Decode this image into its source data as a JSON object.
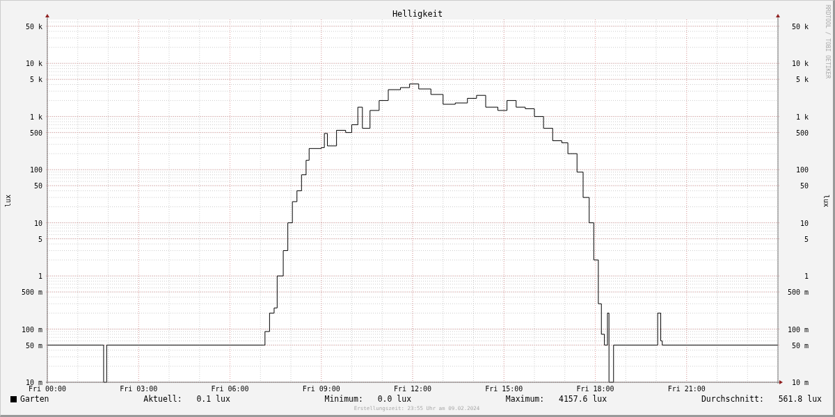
{
  "credit": "RRDTOOL / TOBI OETIKER",
  "graph": {
    "title": "Helligkeit",
    "ylabel": "lux",
    "right_axis_label": "lux",
    "x_tick_labels": [
      "Fri 00:00",
      "Fri 03:00",
      "Fri 06:00",
      "Fri 09:00",
      "Fri 12:00",
      "Fri 15:00",
      "Fri 18:00",
      "Fri 21:00"
    ],
    "y_tick_labels": [
      "50 k",
      "10 k",
      "5 k",
      "1 k",
      "500",
      "100",
      "50",
      "10",
      "5",
      "1",
      "500 m",
      "100 m",
      "50 m",
      "10 m"
    ],
    "right_y_tick_labels": [
      "50 k",
      "10 k",
      "5 k",
      "1 k",
      "500",
      "100",
      "50",
      "10",
      "5",
      "1",
      "500 m",
      "100 m",
      "50 m",
      "10 m"
    ]
  },
  "legend": {
    "series_label": "Garten",
    "color": "#000000",
    "stats": [
      {
        "label": "Aktuell:",
        "value": "0.1 lux"
      },
      {
        "label": "Minimum:",
        "value": "0.0 lux"
      },
      {
        "label": "Maximum:",
        "value": "4157.6 lux"
      },
      {
        "label": "Durchschnitt:",
        "value": "561.8 lux"
      }
    ]
  },
  "footer": "Erstellungszeit: 23:55 Uhr am 09.02.2024"
}
